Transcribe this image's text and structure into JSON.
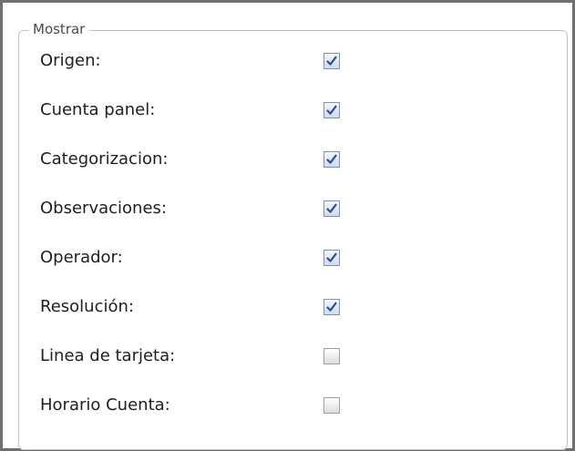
{
  "panel": {
    "legend": "Mostrar"
  },
  "options": [
    {
      "label": "Origen:",
      "checked": true
    },
    {
      "label": "Cuenta panel:",
      "checked": true
    },
    {
      "label": "Categorizacion:",
      "checked": true
    },
    {
      "label": "Observaciones:",
      "checked": true
    },
    {
      "label": "Operador:",
      "checked": true
    },
    {
      "label": "Resolución:",
      "checked": true
    },
    {
      "label": "Linea de tarjeta:",
      "checked": false
    },
    {
      "label": "Horario Cuenta:",
      "checked": false
    }
  ],
  "icons": {
    "checkmark": "checkmark-icon"
  },
  "colors": {
    "checkmark": "#2a4f9a",
    "panel_border": "#b9c4d0",
    "background": "#ffffff"
  }
}
